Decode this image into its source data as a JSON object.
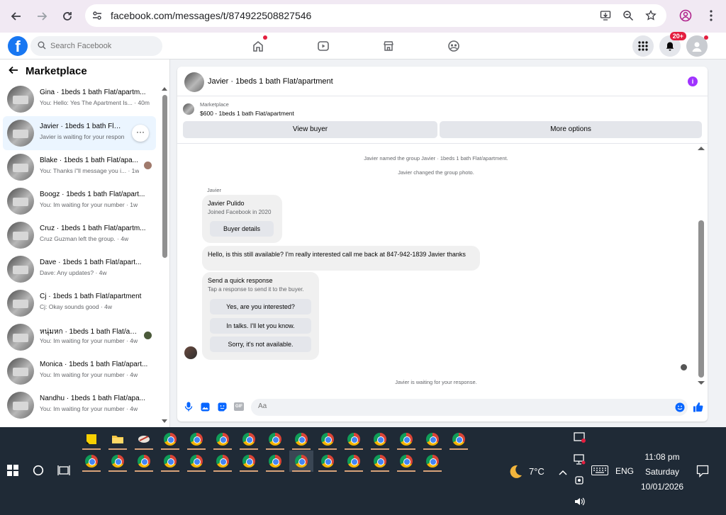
{
  "browser": {
    "url": "facebook.com/messages/t/874922508827546"
  },
  "facebook": {
    "logo_letter": "f",
    "search_placeholder": "Search Facebook",
    "notifications_badge": "20+"
  },
  "sidebar": {
    "title": "Marketplace",
    "conversations": [
      {
        "name": "Gina · 1beds 1 bath Flat/apartm...",
        "preview": "You: Hello: Yes The Apartment Is... · 40m"
      },
      {
        "name": "Javier · 1beds 1 bath Flat/ap...",
        "preview": "Javier is waiting for your respon...",
        "more": "···"
      },
      {
        "name": "Blake · 1beds 1 bath Flat/apa...",
        "preview": "You: Thanks i\"ll message you i... · 1w"
      },
      {
        "name": "Boogz · 1beds 1 bath Flat/apart...",
        "preview": "You: Im waiting for your number · 1w"
      },
      {
        "name": "Cruz · 1beds 1 bath Flat/apartm...",
        "preview": "Cruz Guzman left the group. · 4w"
      },
      {
        "name": "Dave · 1beds 1 bath Flat/apart...",
        "preview": "Dave: Any updates? · 4w"
      },
      {
        "name": "Cj · 1beds 1 bath Flat/apartment",
        "preview": "Cj: Okay sounds good · 4w"
      },
      {
        "name": "หนุ่มหก · 1beds 1 bath Flat/apa...",
        "preview": "You: Im waiting for your number · 4w"
      },
      {
        "name": "Monica · 1beds 1 bath Flat/apart...",
        "preview": "You: Im waiting for your number · 4w"
      },
      {
        "name": "Nandhu · 1beds 1 bath Flat/apa...",
        "preview": "You: Im waiting for your number · 4w"
      }
    ]
  },
  "chat": {
    "title": "Javier · 1beds 1 bath Flat/apartment",
    "info_icon": "i",
    "marketplace_label": "Marketplace",
    "listing": "$600 - 1beds 1 bath Flat/apartment",
    "view_buyer": "View buyer",
    "more_options": "More options",
    "system_1": "Javier named the group Javier · 1beds 1 bath Flat/apartment.",
    "system_2": "Javier changed the group photo.",
    "sender": "Javier",
    "card_name": "Javier Pulido",
    "card_sub": "Joined Facebook in 2020",
    "buyer_details": "Buyer details",
    "message": "Hello, is this still available? I'm really interested  call me back at 847-942-1839 Javier thanks",
    "quick_title": "Send a quick response",
    "quick_sub": "Tap a response to send it to the buyer.",
    "quick_1": "Yes, are you interested?",
    "quick_2": "In talks. I'll let you know.",
    "quick_3": "Sorry, it's not available.",
    "waiting": "Javier is waiting for your response.",
    "composer_placeholder": "Aa",
    "gif_label": "GIF"
  },
  "taskbar": {
    "weather": "7°C",
    "language": "ENG",
    "time": "11:08 pm",
    "day": "Saturday",
    "date": "10/01/2026"
  },
  "colors": {
    "fb_blue": "#1877f2",
    "chrome_bg": "#f1e9f3",
    "taskbar": "#1f2a36",
    "badge_red": "#e41e3f",
    "info_purple": "#a033ff"
  }
}
